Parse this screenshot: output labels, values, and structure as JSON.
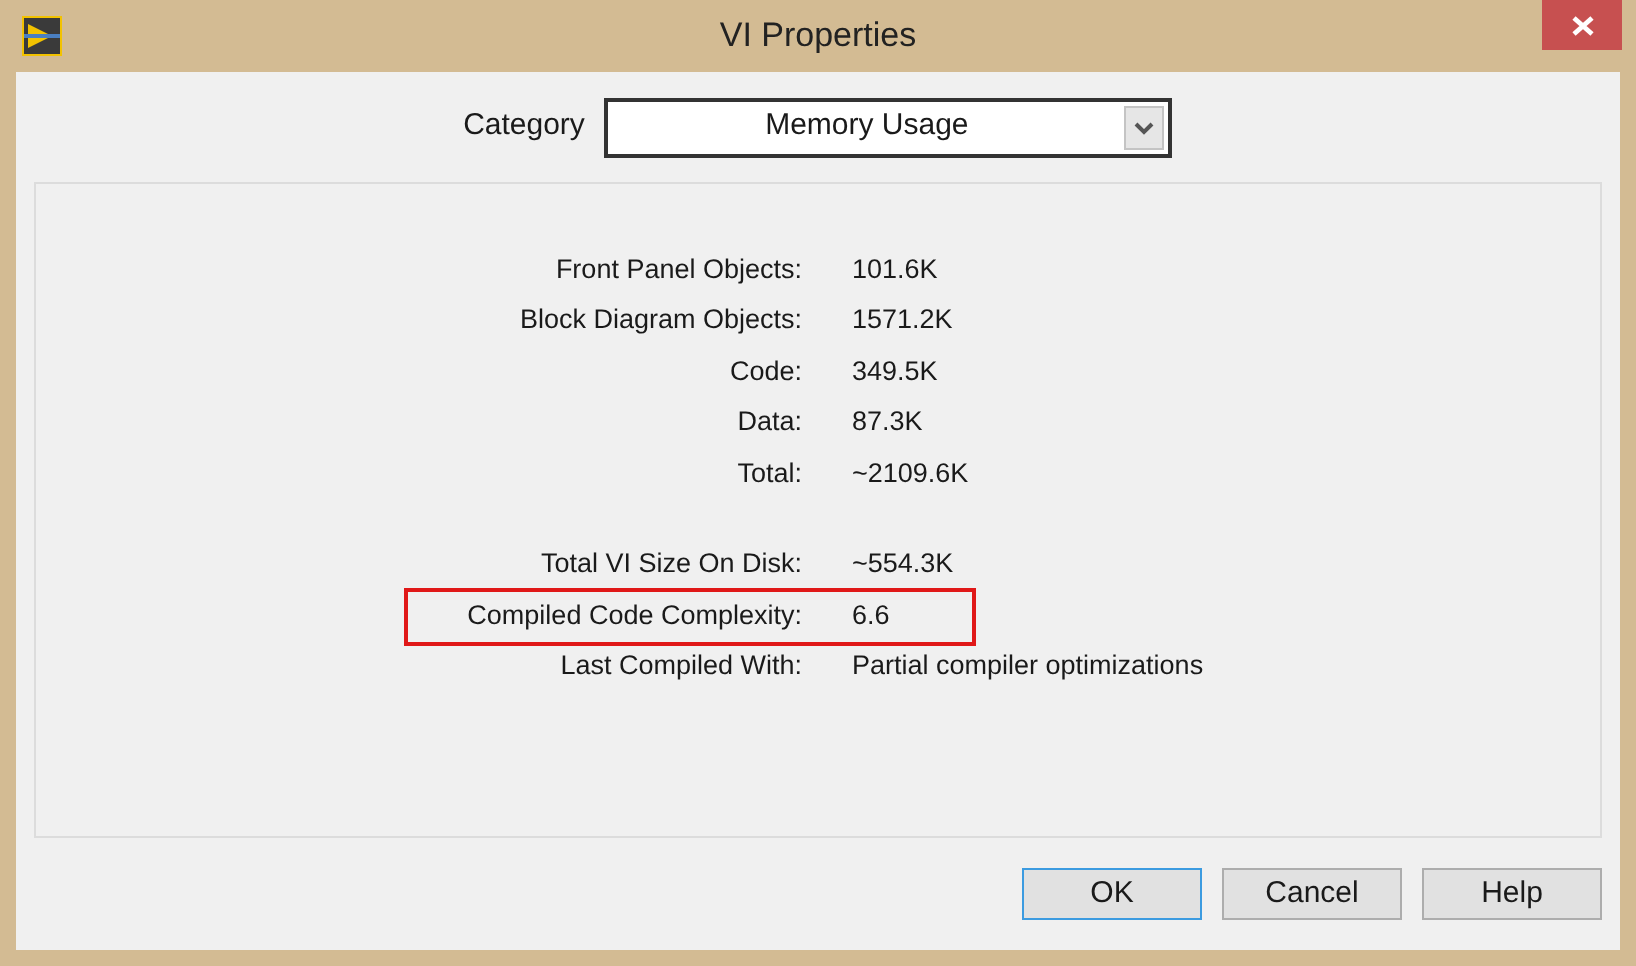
{
  "window": {
    "title": "VI Properties"
  },
  "category": {
    "label": "Category",
    "value": "Memory Usage"
  },
  "groups": [
    {
      "rows": [
        {
          "label": "Front Panel Objects:",
          "value": "101.6K",
          "highlighted": false
        },
        {
          "label": "Block Diagram Objects:",
          "value": "1571.2K",
          "highlighted": false
        },
        {
          "label": "Code:",
          "value": "349.5K",
          "highlighted": false
        },
        {
          "label": "Data:",
          "value": "87.3K",
          "highlighted": false
        },
        {
          "label": "Total:",
          "value": "~2109.6K",
          "highlighted": false
        }
      ]
    },
    {
      "rows": [
        {
          "label": "Total VI Size On Disk:",
          "value": "~554.3K",
          "highlighted": false
        },
        {
          "label": "Compiled Code Complexity:",
          "value": "6.6",
          "highlighted": true
        },
        {
          "label": "Last Compiled With:",
          "value": "Partial compiler optimizations",
          "highlighted": false
        }
      ]
    }
  ],
  "buttons": [
    {
      "label": "OK",
      "default": true
    },
    {
      "label": "Cancel",
      "default": false
    },
    {
      "label": "Help",
      "default": false
    }
  ]
}
